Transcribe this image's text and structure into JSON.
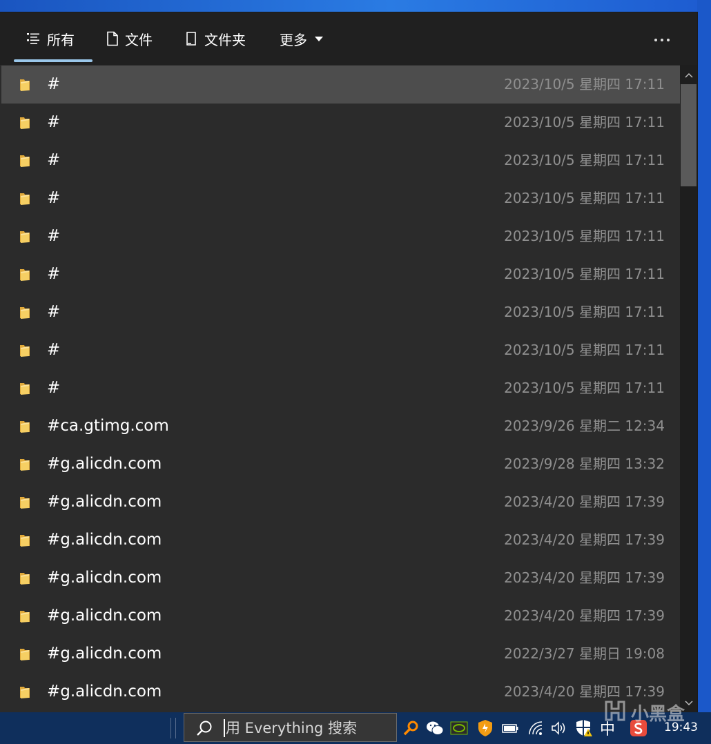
{
  "tabs": [
    {
      "label": "所有",
      "icon": "list-icon",
      "active": true
    },
    {
      "label": "文件",
      "icon": "file-icon",
      "active": false
    },
    {
      "label": "文件夹",
      "icon": "folder-outline-icon",
      "active": false
    },
    {
      "label": "更多",
      "icon": "dropdown-triangle-icon",
      "active": false
    }
  ],
  "more_menu_icon": "ellipsis-icon",
  "results": [
    {
      "name": "#",
      "date": "2023/10/5 星期四 17:11",
      "icon": "folder-icon"
    },
    {
      "name": "#",
      "date": "2023/10/5 星期四 17:11",
      "icon": "folder-icon"
    },
    {
      "name": "#",
      "date": "2023/10/5 星期四 17:11",
      "icon": "folder-icon"
    },
    {
      "name": "#",
      "date": "2023/10/5 星期四 17:11",
      "icon": "folder-icon"
    },
    {
      "name": "#",
      "date": "2023/10/5 星期四 17:11",
      "icon": "folder-icon"
    },
    {
      "name": "#",
      "date": "2023/10/5 星期四 17:11",
      "icon": "folder-icon"
    },
    {
      "name": "#",
      "date": "2023/10/5 星期四 17:11",
      "icon": "folder-icon"
    },
    {
      "name": "#",
      "date": "2023/10/5 星期四 17:11",
      "icon": "folder-icon"
    },
    {
      "name": "#",
      "date": "2023/10/5 星期四 17:11",
      "icon": "folder-icon"
    },
    {
      "name": "#ca.gtimg.com",
      "date": "2023/9/26 星期二 12:34",
      "icon": "folder-icon"
    },
    {
      "name": "#g.alicdn.com",
      "date": "2023/9/28 星期四 13:32",
      "icon": "folder-icon"
    },
    {
      "name": "#g.alicdn.com",
      "date": "2023/4/20 星期四 17:39",
      "icon": "folder-icon"
    },
    {
      "name": "#g.alicdn.com",
      "date": "2023/4/20 星期四 17:39",
      "icon": "folder-icon"
    },
    {
      "name": "#g.alicdn.com",
      "date": "2023/4/20 星期四 17:39",
      "icon": "folder-icon"
    },
    {
      "name": "#g.alicdn.com",
      "date": "2023/4/20 星期四 17:39",
      "icon": "folder-icon"
    },
    {
      "name": "#g.alicdn.com",
      "date": "2022/3/27 星期日 19:08",
      "icon": "folder-icon"
    },
    {
      "name": "#g.alicdn.com",
      "date": "2023/4/20 星期四 17:39",
      "icon": "folder-icon"
    }
  ],
  "selected_index": 0,
  "taskbar": {
    "search_text": "用 Everything 搜索",
    "ime_label": "中",
    "clock": "19:43",
    "tray_icons": [
      "everything-search-icon",
      "wechat-icon",
      "nvidia-icon",
      "security-shield-icon",
      "battery-icon",
      "wifi-icon",
      "volume-icon",
      "windows-security-warning-icon",
      "sogou-ime-icon"
    ]
  },
  "watermark": {
    "text": "小黑盒"
  },
  "colors": {
    "tab_underline": "#9ac7ea",
    "selected_row": "#4d4d4d",
    "list_bg": "#2b2b2b",
    "folder": "#f2c85b",
    "date_text": "#8f8f8f"
  }
}
